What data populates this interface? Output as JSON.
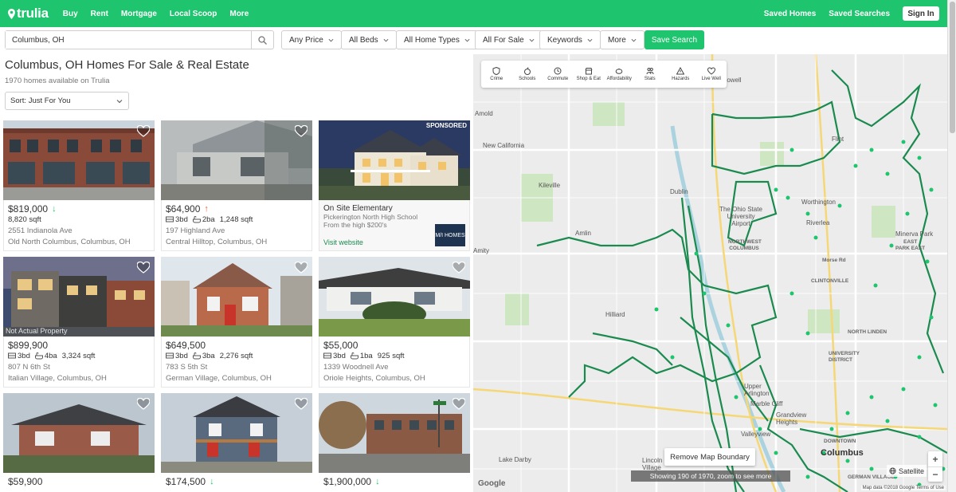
{
  "nav": {
    "logo": "trulia",
    "links": [
      "Buy",
      "Rent",
      "Mortgage",
      "Local Scoop",
      "More"
    ],
    "saved_homes": "Saved Homes",
    "saved_searches": "Saved Searches",
    "sign_in": "Sign In",
    "brand_color": "#1fc46e"
  },
  "filters": {
    "search_value": "Columbus, OH",
    "buttons": [
      "Any Price",
      "All Beds",
      "All Home Types",
      "All For Sale",
      "Keywords",
      "More"
    ],
    "save_search": "Save Search"
  },
  "results": {
    "title": "Columbus, OH Homes For Sale & Real Estate",
    "count": "1970 homes available on Trulia",
    "sort": "Sort: Just For You"
  },
  "listings": [
    {
      "price": "$819,000",
      "trend": "down",
      "beds": "",
      "baths": "",
      "sqft": "8,820 sqft",
      "address": "2551 Indianola Ave",
      "hood": "Old North Columbus, Columbus, OH"
    },
    {
      "price": "$64,900",
      "trend": "up",
      "beds": "3bd",
      "baths": "2ba",
      "sqft": "1,248 sqft",
      "address": "197 Highland Ave",
      "hood": "Central Hilltop, Columbus, OH"
    },
    {
      "sponsored": "SPONSORED",
      "title": "On Site Elementary",
      "line1": "Pickerington North High School",
      "line2": "From the high $200's",
      "link": "Visit website",
      "logo": "M/I HOMES"
    },
    {
      "price": "$899,900",
      "trend": "",
      "beds": "3bd",
      "baths": "4ba",
      "sqft": "3,324 sqft",
      "address": "807 N 6th St",
      "hood": "Italian Village, Columbus, OH",
      "note": "Not Actual Property"
    },
    {
      "price": "$649,500",
      "trend": "",
      "beds": "3bd",
      "baths": "3ba",
      "sqft": "2,276 sqft",
      "address": "783 S 5th St",
      "hood": "German Village, Columbus, OH"
    },
    {
      "price": "$55,000",
      "trend": "",
      "beds": "3bd",
      "baths": "1ba",
      "sqft": "925 sqft",
      "address": "1339 Woodnell Ave",
      "hood": "Oriole Heights, Columbus, OH"
    },
    {
      "price": "$59,900",
      "trend": ""
    },
    {
      "price": "$174,500",
      "trend": "down"
    },
    {
      "price": "$1,900,000",
      "trend": "down"
    }
  ],
  "map": {
    "overlays": [
      "Crime",
      "Schools",
      "Commute",
      "Shop & Eat",
      "Affordability",
      "Stats",
      "Hazards",
      "Live Well"
    ],
    "labels": [
      "Powell",
      "Amold",
      "New California",
      "Kileville",
      "Dublin",
      "The Ohio State University Airport",
      "Worthington",
      "Amlin",
      "Amity",
      "Hilliard",
      "Minerva Park",
      "CLINTONVILLE",
      "Upper Arlington",
      "Grandview Heights",
      "Valleyview",
      "Lake Darby",
      "Lincoln Village",
      "Columbus",
      "DOWNTOWN",
      "Flint",
      "NORTHWEST COLUMBUS",
      "NORTH LINDEN",
      "Marble Cliff",
      "Riverlea",
      "Morse Rd",
      "UNIVERSITY DISTRICT",
      "GERMAN VILLAGE",
      "EAST",
      "PARK EAST"
    ],
    "remove_boundary": "Remove Map Boundary",
    "showing": "Showing 190 of 1970, zoom to see more",
    "zoom_in": "+",
    "zoom_out": "−",
    "satellite": "Satellite",
    "google": "Google",
    "attribution": "Map data ©2018 Google   Terms of Use"
  }
}
